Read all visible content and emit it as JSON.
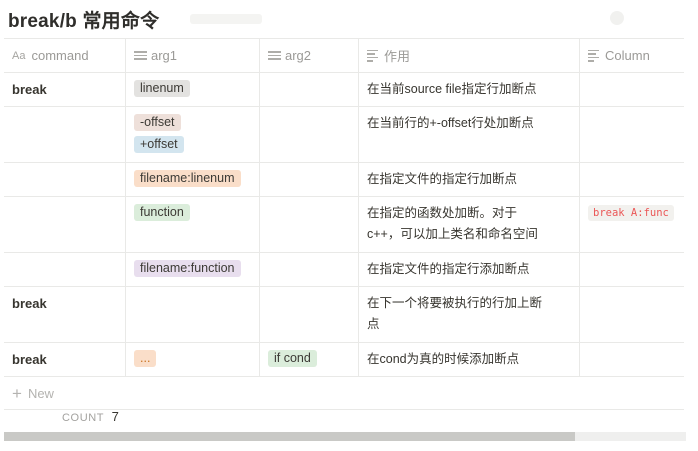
{
  "title": "break/b 常用命令",
  "columns": [
    "command",
    "arg1",
    "arg2",
    "作用",
    "Column"
  ],
  "rows": [
    {
      "command": "break",
      "arg1": [
        "linenum"
      ],
      "arg2": "",
      "desc": "在当前source file指定行加断点",
      "column": ""
    },
    {
      "command": "",
      "arg1": [
        "-offset",
        "+offset"
      ],
      "arg2": "",
      "desc": "在当前行的+-offset行处加断点",
      "column": ""
    },
    {
      "command": "",
      "arg1": [
        "filename:linenum"
      ],
      "arg2": "",
      "desc": "在指定文件的指定行加断点",
      "column": ""
    },
    {
      "command": "",
      "arg1": [
        "function"
      ],
      "arg2": "",
      "desc_lines": [
        "在指定的函数处加断。对于",
        "c++，可以加上类名和命名空间"
      ],
      "column": "break A:func"
    },
    {
      "command": "",
      "arg1": [
        "filename:function"
      ],
      "arg2": "",
      "desc": "在指定文件的指定行添加断点",
      "column": ""
    },
    {
      "command": "break",
      "arg1": [],
      "arg2": "",
      "desc_lines": [
        "在下一个将要被执行的行加上断",
        "点"
      ],
      "column": ""
    },
    {
      "command": "break",
      "arg1": [
        "..."
      ],
      "arg2": "if cond",
      "desc": "在cond为真的时候添加断点",
      "column": ""
    }
  ],
  "new_label": "New",
  "count_label": "COUNT",
  "count_value": "7",
  "scrollbar": {
    "position_fraction": 0.84
  },
  "colors": {
    "tag_gray": "#e3e2e0",
    "tag_brown": "#eee0da",
    "tag_blue": "#d3e5ef",
    "tag_orange": "#fadec9",
    "tag_green": "#dbeddb",
    "tag_purple": "#e8deee",
    "code_red": "#eb5757"
  }
}
